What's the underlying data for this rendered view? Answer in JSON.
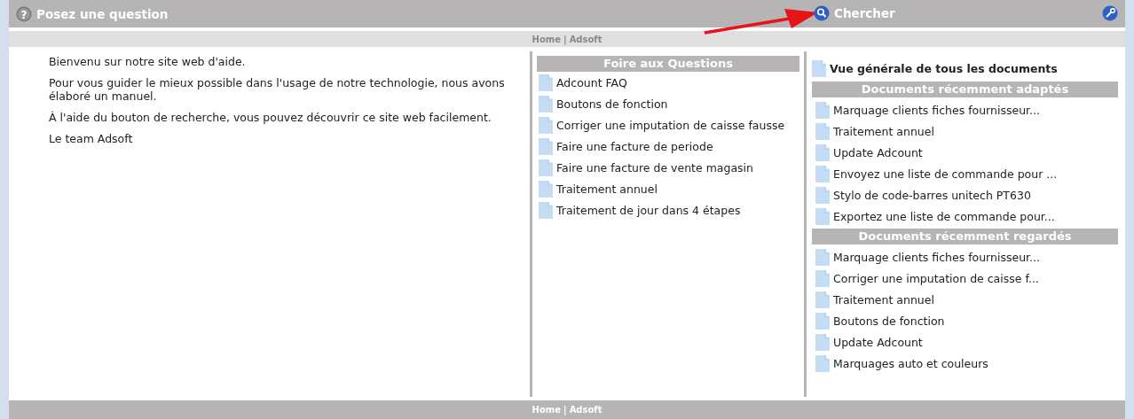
{
  "header": {
    "help_glyph": "?",
    "title": "Posez une question",
    "search_label": "Chercher"
  },
  "breadcrumb": {
    "links": [
      "Home",
      "Adsoft"
    ],
    "separator": "|"
  },
  "intro": {
    "paragraphs": [
      "Bienvenu sur notre site web d'aide.",
      "Pour vous guider le mieux possible dans l'usage de notre technologie, nous avons élaboré un manuel.",
      "À l'aide du bouton de recherche, vous pouvez découvrir ce site web facilement.",
      "Le team Adsoft"
    ]
  },
  "faq": {
    "title": "Foire aux Questions",
    "items": [
      "Adcount FAQ",
      "Boutons de fonction",
      "Corriger une imputation de caisse fausse",
      "Faire une facture de periode",
      "Faire une facture de vente magasin",
      "Traitement annuel",
      "Traitement de jour dans 4 étapes"
    ]
  },
  "overview_link": "Vue générale de tous les documents",
  "recently_adapted": {
    "title": "Documents récemment adaptés",
    "items": [
      "Marquage clients fiches fournisseur...",
      "Traitement annuel",
      "Update Adcount",
      "Envoyez une liste de commande pour ...",
      "Stylo de code-barres unitech PT630",
      "Exportez une liste de commande pour..."
    ]
  },
  "recently_viewed": {
    "title": "Documents récemment regardés",
    "items": [
      "Marquage clients fiches fournisseur...",
      "Corriger une imputation de caisse f...",
      "Traitement annuel",
      "Boutons de fonction",
      "Update Adcount",
      "Marquages auto et couleurs"
    ]
  },
  "footer": {
    "links": [
      "Home",
      "Adsoft"
    ],
    "separator": "|"
  }
}
